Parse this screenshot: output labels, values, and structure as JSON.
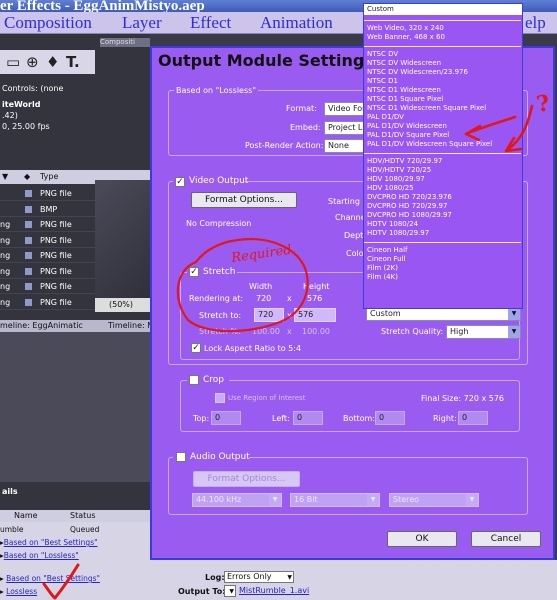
{
  "window_title": "er Effects - EggAnimMistyo.aep",
  "menu": [
    "Composition",
    "Layer",
    "Effect",
    "Animation",
    "elp"
  ],
  "left_panel": {
    "tabs": [
      "Compositi",
      "Layer: (non"
    ],
    "controls_label": "Controls: (none",
    "project_name": "iteWorld",
    "project_info_1": ".42)",
    "project_info_2": "0, 25.00 fps",
    "type_header": "Type",
    "files": [
      {
        "name": "",
        "type": "PNG file"
      },
      {
        "name": "",
        "type": "BMP"
      },
      {
        "name": "ng",
        "type": "PNG file"
      },
      {
        "name": "ng",
        "type": "PNG file"
      },
      {
        "name": "ng",
        "type": "PNG file"
      },
      {
        "name": "ng",
        "type": "PNG file"
      },
      {
        "name": "ng",
        "type": "PNG file"
      },
      {
        "name": "ng",
        "type": "PNG file"
      }
    ],
    "zoom": "(50%)",
    "timeline_tabs": [
      "meline: EggAnimatic",
      "Timeline: M"
    ]
  },
  "render_queue": {
    "title": "ails",
    "col_name": "Name",
    "col_status": "Status",
    "rows": [
      {
        "text": "umble",
        "status": "Queued"
      },
      {
        "text": "Based on \"Best Settings\"",
        "link": true
      },
      {
        "text": "Based on \"Lossless\"",
        "link": true
      },
      {
        "text": "umble",
        "status": "Queued"
      },
      {
        "text": "Based on \"Best Settings\"",
        "link": true
      },
      {
        "text": "Lossless",
        "link": true
      }
    ],
    "log_label": "Log:",
    "log_value": "Errors Only",
    "output_to_label": "Output To:",
    "output_to_value": "MistRumble_1.avi"
  },
  "dialog": {
    "title": "Output Module Settings",
    "based_on": "Based on \"Lossless\"",
    "format_label": "Format:",
    "format_value": "Video For",
    "embed_label": "Embed:",
    "embed_value": "Project Li",
    "post_render_label": "Post-Render Action:",
    "post_render_value": "None",
    "video_output_label": "Video Output",
    "format_options_button": "Format Options...",
    "compression": "No Compression",
    "starting_label": "Starting #",
    "channels_label": "Channels",
    "depth_label": "Depth",
    "color_label": "Color",
    "stretch": {
      "label": "Stretch",
      "width_header": "Width",
      "height_header": "Height",
      "rendering_at_label": "Rendering at:",
      "rendering_w": "720",
      "rendering_h": "576",
      "stretch_to_label": "Stretch to:",
      "stretch_w": "720",
      "stretch_h": "576",
      "stretch_pct_label": "Stretch %:",
      "pct_w": "100.00",
      "pct_h": "100.00",
      "size_preset": "Custom",
      "quality_label": "Stretch Quality:",
      "quality_value": "High",
      "lock_label": "Lock Aspect Ratio to 5:4"
    },
    "crop": {
      "label": "Crop",
      "region_label": "Use Region of Interest",
      "final_size": "Final Size: 720 x 576",
      "top_label": "Top:",
      "top_value": "0",
      "left_label": "Left:",
      "left_value": "0",
      "bottom_label": "Bottom:",
      "bottom_value": "0",
      "right_label": "Right:",
      "right_value": "0"
    },
    "audio": {
      "label": "Audio Output",
      "format_options_button": "Format Options...",
      "rate": "44.100 kHz",
      "bits": "16 Bit",
      "channels": "Stereo"
    },
    "ok_button": "OK",
    "cancel_button": "Cancel"
  },
  "format_list": {
    "selected": "Custom",
    "groups": [
      [
        "Web Video, 320 x 240",
        "Web Banner, 468 x 60"
      ],
      [
        "NTSC DV",
        "NTSC DV Widescreen",
        "NTSC DV Widescreen/23.976",
        "NTSC D1",
        "NTSC D1 Widescreen",
        "NTSC D1 Square Pixel",
        "NTSC D1 Widescreen Square Pixel",
        "PAL D1/DV",
        "PAL D1/DV Widescreen",
        "PAL D1/DV Square Pixel",
        "PAL D1/DV Widescreen Square Pixel"
      ],
      [
        "HDV/HDTV 720/29.97",
        "HDV/HDTV 720/25",
        "HDV 1080/29.97",
        "HDV 1080/25",
        "DVCPRO HD 720/23.976",
        "DVCPRO HD 720/29.97",
        "DVCPRO HD 1080/29.97",
        "HDTV 1080/24",
        "HDTV 1080/29.97"
      ],
      [
        "Cineon Half",
        "Cineon Full",
        "Film (2K)",
        "Film (4K)"
      ]
    ]
  },
  "annotations": {
    "required": "Required",
    "question": "?",
    "color": "#e01818"
  }
}
